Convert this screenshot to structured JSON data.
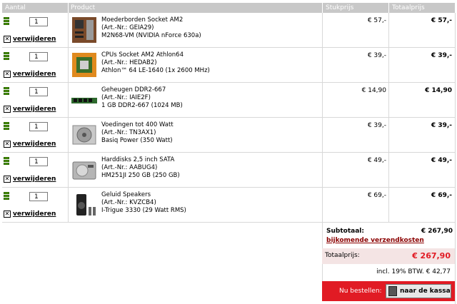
{
  "header": {
    "col_aantal": "Aantal",
    "col_product": "Product",
    "col_stukprijs": "Stukprijs",
    "col_totaalprijs": "Totaalprijs"
  },
  "remove_label": "verwijderen",
  "items": [
    {
      "qty": "1",
      "name": "Moederborden Socket AM2",
      "artnr": "(Art.-Nr.: GEIA29)",
      "spec": "M2N68-VM (NVIDIA nForce 630a)",
      "unit": "€ 57,-",
      "total": "€ 57,-",
      "icon": "motherboard-icon"
    },
    {
      "qty": "1",
      "name": "CPUs Socket AM2 Athlon64",
      "artnr": "(Art.-Nr.: HEDAB2)",
      "spec": "Athlon™ 64 LE-1640 (1x 2600 MHz)",
      "unit": "€ 39,-",
      "total": "€ 39,-",
      "icon": "cpu-icon"
    },
    {
      "qty": "1",
      "name": "Geheugen DDR2-667",
      "artnr": "(Art.-Nr.: IAIE2F)",
      "spec": "1 GB DDR2-667 (1024 MB)",
      "unit": "€ 14,90",
      "total": "€ 14,90",
      "icon": "memory-icon"
    },
    {
      "qty": "1",
      "name": "Voedingen tot 400 Watt",
      "artnr": "(Art.-Nr.: TN3AX1)",
      "spec": "Basiq Power (350 Watt)",
      "unit": "€ 39,-",
      "total": "€ 39,-",
      "icon": "psu-icon"
    },
    {
      "qty": "1",
      "name": "Harddisks 2,5 inch SATA",
      "artnr": "(Art.-Nr.: AABUG4)",
      "spec": "HM251JI 250 GB (250 GB)",
      "unit": "€ 49,-",
      "total": "€ 49,-",
      "icon": "harddisk-icon"
    },
    {
      "qty": "1",
      "name": "Geluid Speakers",
      "artnr": "(Art.-Nr.: KVZCB4)",
      "spec": "I-Trigue 3330 (29 Watt RMS)",
      "unit": "€ 69,-",
      "total": "€ 69,-",
      "icon": "speakers-icon"
    }
  ],
  "summary": {
    "subtotal_label": "Subtotaal:",
    "subtotal_value": "€ 267,90",
    "shipping_label": "bijkomende verzendkosten",
    "total_label": "Totaalprijs:",
    "total_value": "€ 267,90",
    "btw": "incl. 19% BTW. € 42,77"
  },
  "checkout": {
    "prompt": "Nu bestellen:",
    "button": "naar de kassa"
  }
}
